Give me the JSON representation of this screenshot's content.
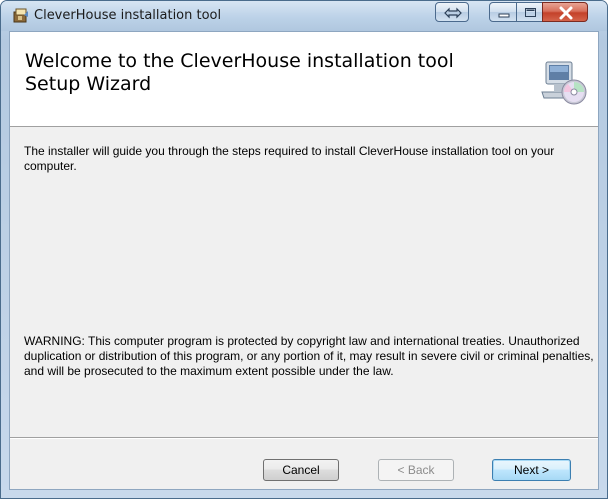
{
  "window": {
    "title": "CleverHouse installation tool"
  },
  "banner": {
    "title_line1": "Welcome to the CleverHouse installation tool",
    "title_line2": "Setup Wizard"
  },
  "body": {
    "intro": "The installer will guide you through the steps required to install CleverHouse installation tool on your computer.",
    "warning": "WARNING: This computer program is protected by copyright law and international treaties. Unauthorized duplication or distribution of this program, or any portion of it, may result in severe civil or criminal penalties, and will be prosecuted to the maximum extent possible under the law."
  },
  "buttons": {
    "cancel": "Cancel",
    "back": "< Back",
    "next": "Next >"
  },
  "icons": {
    "app": "installer-icon",
    "banner": "computer-cd-icon",
    "restore_alt": "double-arrow-icon",
    "minimize": "minimize-icon",
    "maximize": "maximize-icon",
    "close": "close-icon"
  },
  "colors": {
    "title_bar": "#bcd2e8",
    "client_bg": "#f0f0f0",
    "close_button": "#c4412a",
    "default_button_border": "#3c7fb1"
  }
}
